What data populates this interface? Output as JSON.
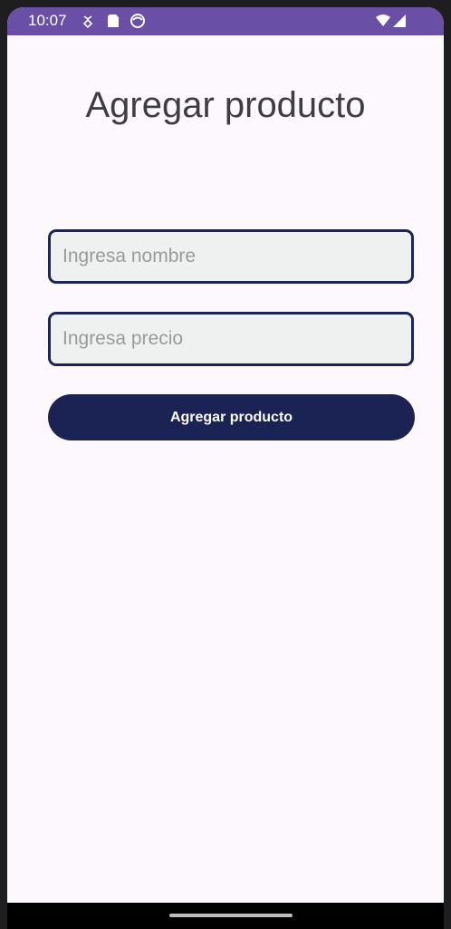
{
  "status_bar": {
    "time": "10:07",
    "icons_left": [
      "bug-icon",
      "sd-card-icon",
      "circle-face-icon"
    ],
    "icons_right": [
      "wifi-icon",
      "signal-icon"
    ],
    "background_color": "#6a4fa6"
  },
  "page": {
    "title": "Agregar producto"
  },
  "form": {
    "name_placeholder": "Ingresa nombre",
    "name_value": "",
    "price_placeholder": "Ingresa precio",
    "price_value": "",
    "submit_label": "Agregar producto"
  },
  "colors": {
    "accent": "#1b2355",
    "field_border": "#1d2457",
    "field_fill": "#eff0f0",
    "background": "#fdf8fd"
  }
}
